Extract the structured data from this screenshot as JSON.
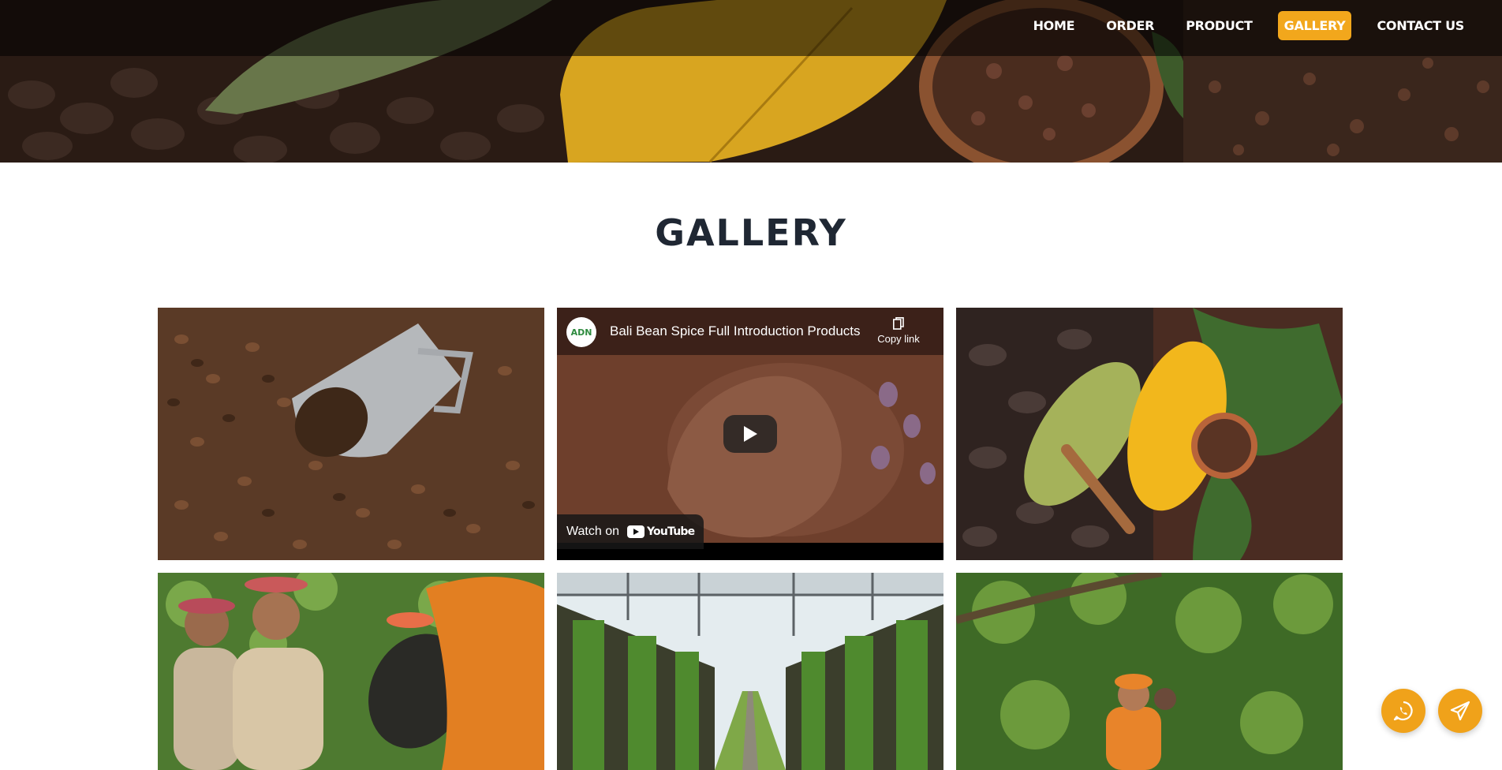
{
  "nav": {
    "items": [
      {
        "label": "HOME",
        "active": false
      },
      {
        "label": "ORDER",
        "active": false
      },
      {
        "label": "PRODUCT",
        "active": false
      },
      {
        "label": "GALLERY",
        "active": true
      },
      {
        "label": "CONTACT US",
        "active": false
      }
    ],
    "accent_color": "#f2a71c"
  },
  "page": {
    "title": "GALLERY"
  },
  "gallery": {
    "video": {
      "title": "Bali Bean Spice Full Introduction Products",
      "copy_link_label": "Copy link",
      "watch_on_label": "Watch on",
      "brand_label": "YouTube",
      "channel_logo_text": "ADN"
    },
    "images": [
      {
        "name": "coffee-beans-scoop"
      },
      {
        "name": "cacao-pods-nibs"
      },
      {
        "name": "farmers-sorting"
      },
      {
        "name": "vanilla-greenhouse"
      },
      {
        "name": "farmer-plantation"
      }
    ]
  },
  "floating": {
    "whatsapp_icon": "whatsapp-icon",
    "send_icon": "paper-plane-icon",
    "color": "#f0a21a"
  }
}
